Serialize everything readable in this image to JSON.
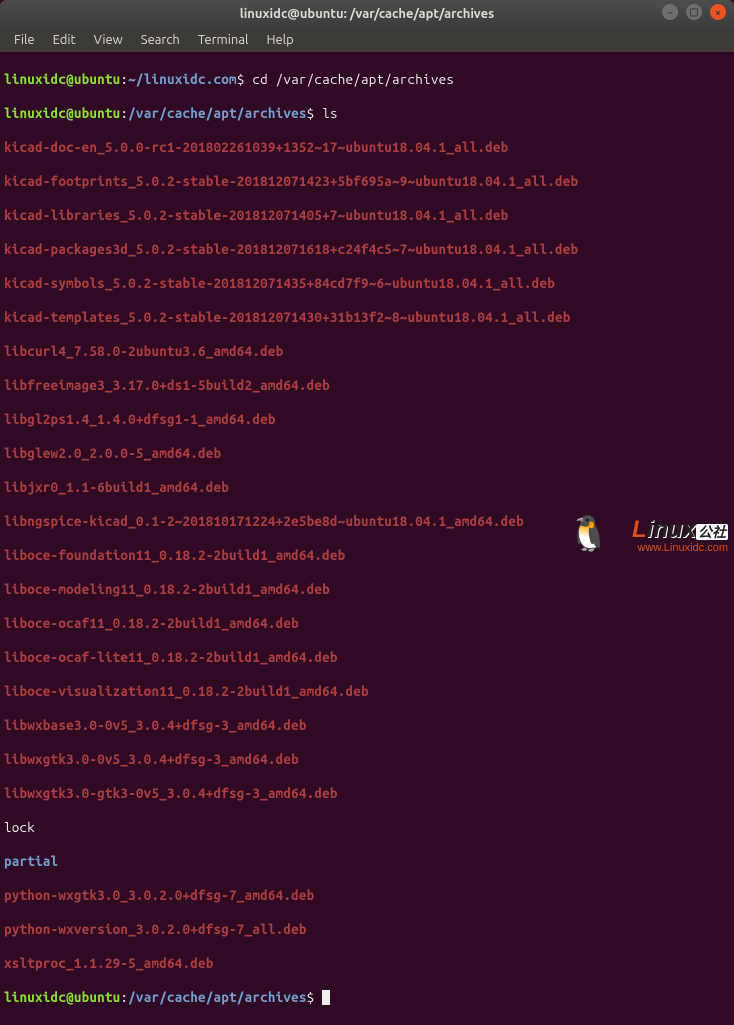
{
  "window": {
    "title": "linuxidc@ubuntu: /var/cache/apt/archives"
  },
  "menu": {
    "file": "File",
    "edit": "Edit",
    "view": "View",
    "search": "Search",
    "terminal": "Terminal",
    "help": "Help"
  },
  "prompt1": {
    "userhost": "linuxidc@ubuntu",
    "sep": ":",
    "path": "~/linuxidc.com",
    "sigil": "$",
    "command": "cd /var/cache/apt/archives"
  },
  "prompt2": {
    "userhost": "linuxidc@ubuntu",
    "sep": ":",
    "path": "/var/cache/apt/archives",
    "sigil": "$",
    "command": "ls"
  },
  "listing": {
    "debs": [
      "kicad-doc-en_5.0.0-rc1-201802261039+1352~17~ubuntu18.04.1_all.deb",
      "kicad-footprints_5.0.2-stable-201812071423+5bf695a~9~ubuntu18.04.1_all.deb",
      "kicad-libraries_5.0.2-stable-201812071405+7~ubuntu18.04.1_all.deb",
      "kicad-packages3d_5.0.2-stable-201812071618+c24f4c5~7~ubuntu18.04.1_all.deb",
      "kicad-symbols_5.0.2-stable-201812071435+84cd7f9~6~ubuntu18.04.1_all.deb",
      "kicad-templates_5.0.2-stable-201812071430+31b13f2~8~ubuntu18.04.1_all.deb",
      "libcurl4_7.58.0-2ubuntu3.6_amd64.deb",
      "libfreeimage3_3.17.0+ds1-5build2_amd64.deb",
      "libgl2ps1.4_1.4.0+dfsg1-1_amd64.deb",
      "libglew2.0_2.0.0-5_amd64.deb",
      "libjxr0_1.1-6build1_amd64.deb",
      "libngspice-kicad_0.1-2~201810171224+2e5be8d~ubuntu18.04.1_amd64.deb",
      "liboce-foundation11_0.18.2-2build1_amd64.deb",
      "liboce-modeling11_0.18.2-2build1_amd64.deb",
      "liboce-ocaf11_0.18.2-2build1_amd64.deb",
      "liboce-ocaf-lite11_0.18.2-2build1_amd64.deb",
      "liboce-visualization11_0.18.2-2build1_amd64.deb",
      "libwxbase3.0-0v5_3.0.4+dfsg-3_amd64.deb",
      "libwxgtk3.0-0v5_3.0.4+dfsg-3_amd64.deb",
      "libwxgtk3.0-gtk3-0v5_3.0.4+dfsg-3_amd64.deb"
    ],
    "plain": "lock",
    "dir": "partial",
    "debs2": [
      "python-wxgtk3.0_3.0.2.0+dfsg-7_amd64.deb",
      "python-wxversion_3.0.2.0+dfsg-7_all.deb",
      "xsltproc_1.1.29-5_amd64.deb"
    ]
  },
  "prompt3": {
    "userhost": "linuxidc@ubuntu",
    "sep": ":",
    "path": "/var/cache/apt/archives",
    "sigil": "$"
  },
  "watermark": {
    "text1": "L",
    "text2": "inux",
    "cn": "公社",
    "url": "www.Linuxidc.com"
  }
}
